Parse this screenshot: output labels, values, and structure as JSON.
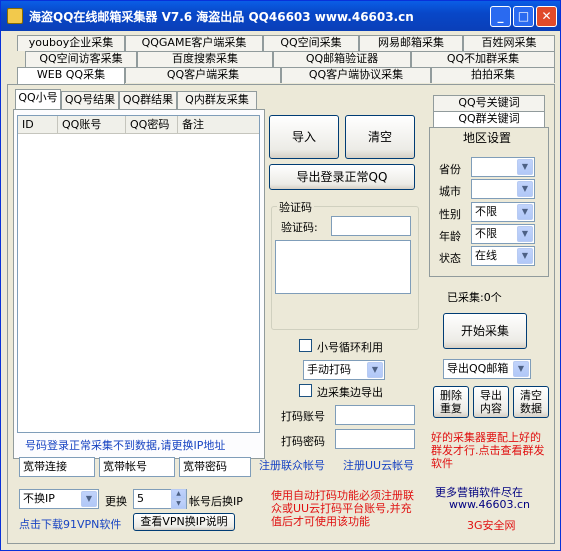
{
  "window": {
    "title": "海盗QQ在线邮箱采集器 V7.6  海盗出品 QQ46603 www.46603.cn",
    "minimize": "_",
    "maximize": "□",
    "close": "✕"
  },
  "top_tabs": {
    "row1": [
      "youboy企业采集",
      "QQGAME客户端采集",
      "QQ空间采集",
      "网易邮箱采集",
      "百姓网采集"
    ],
    "row2": [
      "QQ空间访客采集",
      "百度搜索采集",
      "QQ邮箱验证器",
      "QQ不加群采集"
    ],
    "row3": [
      "WEB QQ采集",
      "QQ客户端采集",
      "QQ客户端协议采集",
      "拍拍采集"
    ]
  },
  "sub_tabs": [
    "QQ小号",
    "QQ号结果",
    "QQ群结果",
    "Q内群友采集"
  ],
  "list": {
    "columns": [
      "ID",
      "QQ账号",
      "QQ密码",
      "备注"
    ]
  },
  "buttons": {
    "import": "导入",
    "clear": "清空",
    "export_normal": "导出登录正常QQ",
    "start": "开始采集",
    "dedupe": "删除\n重复",
    "export_content": "导出\n内容",
    "clear_data": "清空\n数据",
    "vpn_help": "查看VPN换IP说明"
  },
  "captcha": {
    "group_label": "验证码",
    "field_label": "验证码:",
    "value": ""
  },
  "options": {
    "loop_label": "小号循环利用",
    "loop_checked": false,
    "captcha_mode": "手动打码",
    "export_while_label": "边采集边导出",
    "export_while_checked": false,
    "coder_account_label": "打码账号",
    "coder_password_label": "打码密码",
    "register_lianzhong": "注册联众帐号",
    "register_uuyun": "注册UU云帐号"
  },
  "hint_ip": "号码登录正常采集不到数据,请更换IP地址",
  "broadband": {
    "connection": "宽带连接",
    "account": "宽带帐号",
    "password": "宽带密码"
  },
  "ip_change": {
    "mode": "不换IP",
    "label_change": "更换",
    "count": "5",
    "label_after": "帐号后换IP",
    "download_vpn": "点击下载91VPN软件"
  },
  "coder_notice": "使用自动打码功能必须注册联众或UU云打码平台账号,并充值后才可使用该功能",
  "right_tabs": [
    "QQ号关键词",
    "QQ群关键词"
  ],
  "region": {
    "title": "地区设置",
    "fields": [
      {
        "label": "省份",
        "value": ""
      },
      {
        "label": "城市",
        "value": ""
      },
      {
        "label": "性别",
        "value": "不限"
      },
      {
        "label": "年龄",
        "value": "不限"
      },
      {
        "label": "状态",
        "value": "在线"
      }
    ]
  },
  "collected": "已采集:0个",
  "export_target": "导出QQ邮箱",
  "promo_red": "好的采集器要配上好的群发才行.点击查看群发软件",
  "promo_more": "更多营销软件尽在",
  "promo_url": "www.46603.cn",
  "promo_brand": "3G安全网"
}
